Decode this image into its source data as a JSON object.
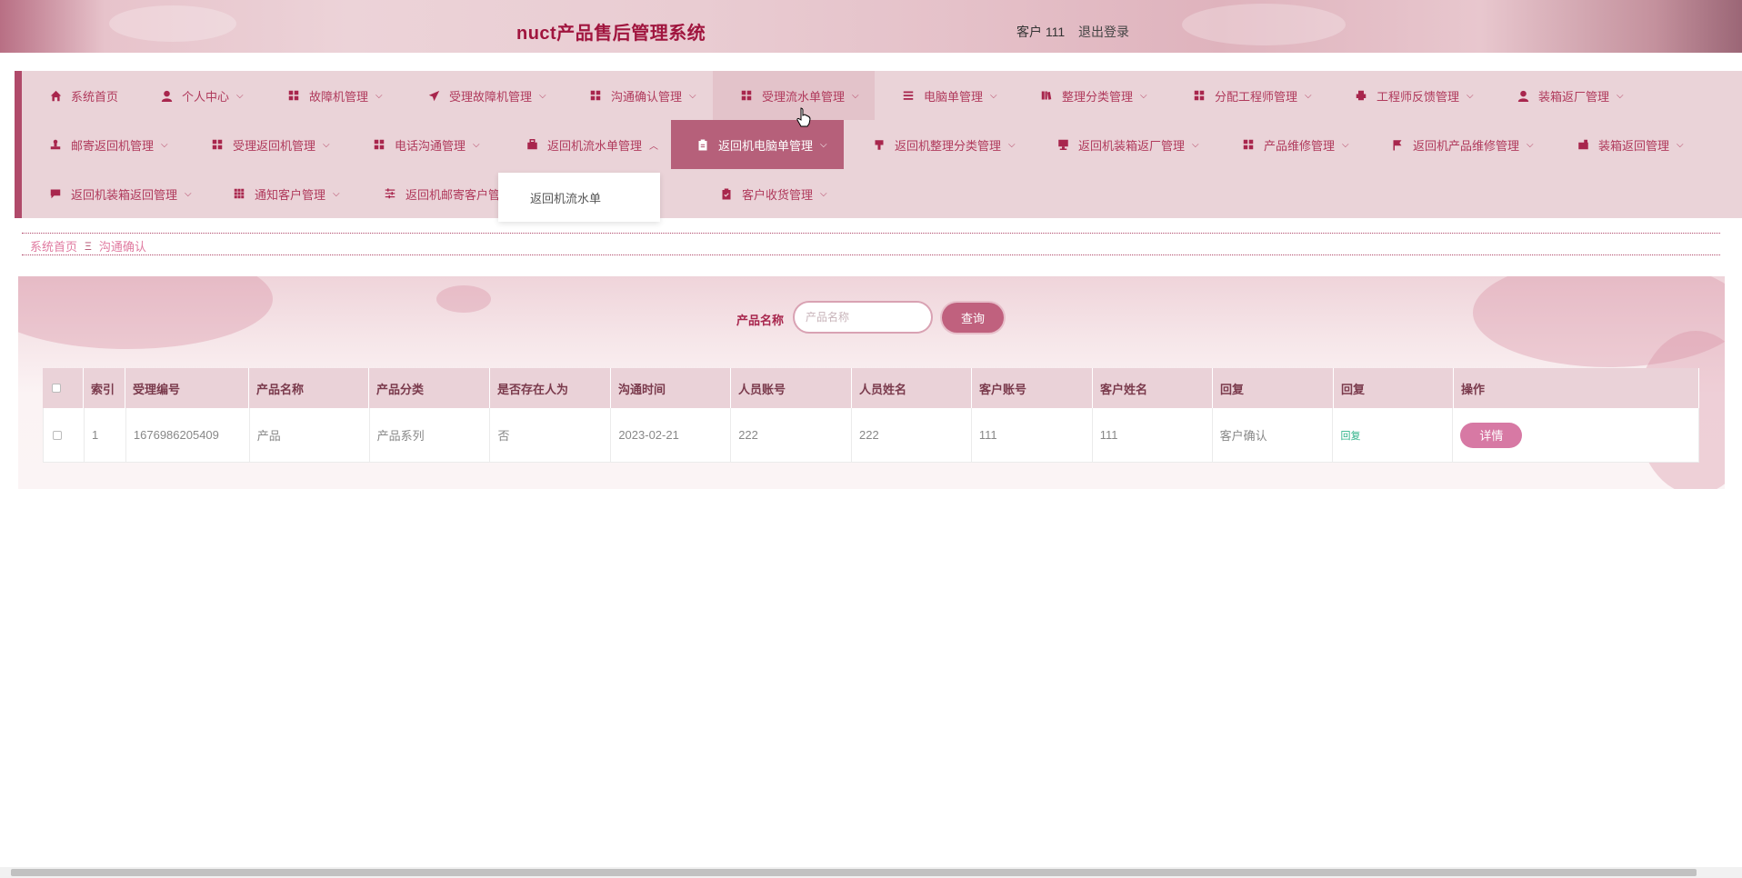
{
  "header": {
    "title": "nuct产品售后管理系统",
    "user": "客户 111",
    "logout": "退出登录"
  },
  "nav": {
    "row1": [
      {
        "label": "系统首页",
        "icon": "home-icon"
      },
      {
        "label": "个人中心",
        "icon": "user-icon"
      },
      {
        "label": "故障机管理",
        "icon": "grid-icon"
      },
      {
        "label": "受理故障机管理",
        "icon": "send-icon"
      },
      {
        "label": "沟通确认管理",
        "icon": "grid-icon"
      },
      {
        "label": "受理流水单管理",
        "icon": "grid-icon"
      },
      {
        "label": "电脑单管理",
        "icon": "list-icon"
      },
      {
        "label": "整理分类管理",
        "icon": "book-icon"
      },
      {
        "label": "分配工程师管理",
        "icon": "grid-icon"
      },
      {
        "label": "工程师反馈管理",
        "icon": "printer-icon"
      },
      {
        "label": "装箱返厂管理",
        "icon": "user-icon"
      }
    ],
    "row2": [
      {
        "label": "邮寄返回机管理",
        "icon": "stamp-icon"
      },
      {
        "label": "受理返回机管理",
        "icon": "grid-icon"
      },
      {
        "label": "电话沟通管理",
        "icon": "grid-icon"
      },
      {
        "label": "返回机流水单管理",
        "icon": "briefcase-icon"
      },
      {
        "label": "返回机电脑单管理",
        "icon": "clipboard-icon"
      },
      {
        "label": "返回机整理分类管理",
        "icon": "brush-icon"
      },
      {
        "label": "返回机装箱返厂管理",
        "icon": "monitor-icon"
      },
      {
        "label": "产品维修管理",
        "icon": "grid-icon"
      },
      {
        "label": "返回机产品维修管理",
        "icon": "flag-icon"
      },
      {
        "label": "装箱返回管理",
        "icon": "toolbox-icon"
      }
    ],
    "row3": [
      {
        "label": "返回机装箱返回管理",
        "icon": "comment-icon"
      },
      {
        "label": "通知客户管理",
        "icon": "apps-icon"
      },
      {
        "label": "返回机邮寄客户管理",
        "icon": "sliders-icon"
      },
      {
        "label": "客户收货管理",
        "icon": "clipboard-check-icon"
      }
    ],
    "dropdown": {
      "item": "返回机流水单"
    }
  },
  "breadcrumb": {
    "home": "系统首页",
    "current": "沟通确认"
  },
  "search": {
    "label": "产品名称",
    "placeholder": "产品名称",
    "button": "查询"
  },
  "table": {
    "headers": [
      "索引",
      "受理编号",
      "产品名称",
      "产品分类",
      "是否存在人为",
      "沟通时间",
      "人员账号",
      "人员姓名",
      "客户账号",
      "客户姓名",
      "回复",
      "回复",
      "操作"
    ],
    "rows": [
      {
        "index": "1",
        "cells": [
          "1676986205409",
          "产品",
          "产品系列",
          "否",
          "2023-02-21",
          "222",
          "222",
          "111",
          "111",
          "客户确认"
        ],
        "reply_link": "回复",
        "action": "详情"
      }
    ]
  },
  "colors": {
    "accent": "#a8264d",
    "nav_bg": "#ead3d8",
    "nav_active": "#b6607a",
    "button": "#c0617e"
  }
}
